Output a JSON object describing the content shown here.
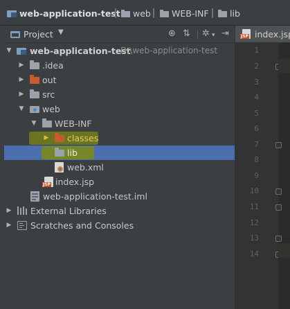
{
  "breadcrumb": {
    "items": [
      {
        "label": "web-application-test",
        "icon": "project-folder-icon"
      },
      {
        "label": "web",
        "icon": "folder-icon"
      },
      {
        "label": "WEB-INF",
        "icon": "folder-icon"
      },
      {
        "label": "lib",
        "icon": "folder-icon"
      }
    ]
  },
  "project_panel": {
    "title": "Project",
    "header_icons": [
      "target-icon",
      "collapse-icon",
      "settings-icon",
      "hide-icon"
    ]
  },
  "tree": {
    "root": {
      "label": "web-application-test",
      "path": "D:\\web-application-test"
    },
    "idea": ".idea",
    "out": "out",
    "src": "src",
    "web": "web",
    "webinf": "WEB-INF",
    "classes": "classes",
    "lib": "lib",
    "webxml": "web.xml",
    "indexjsp": "index.jsp",
    "iml": "web-application-test.iml",
    "external_libraries": "External Libraries",
    "scratches": "Scratches and Consoles"
  },
  "editor": {
    "tab": "index.jsp",
    "line_numbers": [
      "1",
      "2",
      "3",
      "4",
      "5",
      "6",
      "7",
      "8",
      "9",
      "10",
      "11",
      "12",
      "13",
      "14"
    ]
  },
  "colors": {
    "background": "#3c3f41",
    "selection": "#4b6eaf",
    "highlight": "#6f7a1e",
    "folder_orange": "#c75c2e",
    "folder_blue": "#7e9ec2",
    "folder_gray": "#9aa3ab"
  }
}
